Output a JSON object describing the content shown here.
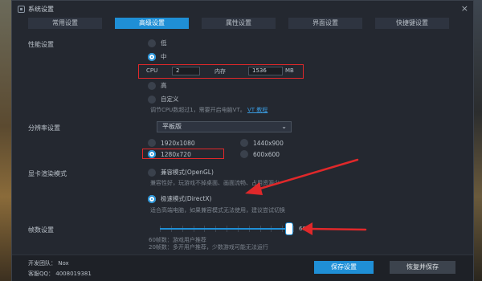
{
  "window": {
    "title": "系统设置",
    "close_glyph": "×"
  },
  "tabs": [
    {
      "label": "常用设置"
    },
    {
      "label": "高级设置"
    },
    {
      "label": "属性设置"
    },
    {
      "label": "界面设置"
    },
    {
      "label": "快捷键设置"
    }
  ],
  "performance": {
    "label": "性能设置",
    "options": {
      "low": "低",
      "medium": "中",
      "high": "高",
      "custom": "自定义"
    },
    "selected": "中",
    "cpu_label": "CPU",
    "cpu_value": "2",
    "memory_label": "内存",
    "memory_value": "1536",
    "memory_unit": "MB",
    "hint_text": "调节CPU数超过1，需要开启电脑VT。",
    "hint_link": "VT 教程"
  },
  "resolution": {
    "label": "分辨率设置",
    "dropdown_value": "平板版",
    "options": [
      "1920x1080",
      "1440x900",
      "1280x720",
      "600x600"
    ],
    "selected": "1280x720"
  },
  "render": {
    "label": "显卡渲染模式",
    "compat_label": "兼容模式(OpenGL)",
    "compat_hint": "兼容性好，玩游戏不掉桌面、画面流畅、占用资源少",
    "speed_label": "极速模式(DirectX)",
    "speed_hint": "适合高端电脑，如果兼容模式无法使用，建议尝试切换",
    "selected": "极速模式(DirectX)"
  },
  "fps": {
    "label": "帧数设置",
    "value": "60",
    "fraction": 0.97,
    "hint1": "60帧数：游戏用户推荐",
    "hint2": "20帧数：多开用户推荐，少数游戏可能无法运行"
  },
  "footer": {
    "team_label": "开发团队：",
    "team_value": "Nox",
    "qq_label": "客服QQ：",
    "qq_value": "4008019381",
    "save_button": "保存设置",
    "restore_button": "恢复并保存"
  },
  "colors": {
    "accent": "#1f8fd6",
    "annotation_red": "#e0282a",
    "background": "#242830"
  }
}
